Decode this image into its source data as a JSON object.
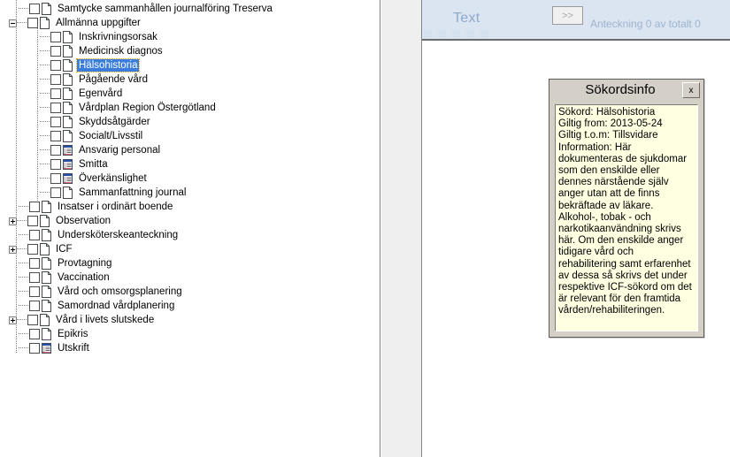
{
  "tree": {
    "items": [
      {
        "label": "Samtycke sammanhållen journalföring Treserva",
        "level": 1,
        "twisty": "none",
        "icon": "document-icon",
        "selected": false
      },
      {
        "label": "Allmänna uppgifter",
        "level": 1,
        "twisty": "minus",
        "icon": "document-icon",
        "selected": false
      },
      {
        "label": "Inskrivningsorsak",
        "level": 2,
        "twisty": "none",
        "icon": "document-icon",
        "selected": false
      },
      {
        "label": "Medicinsk diagnos",
        "level": 2,
        "twisty": "none",
        "icon": "document-icon",
        "selected": false
      },
      {
        "label": "Hälsohistoria",
        "level": 2,
        "twisty": "none",
        "icon": "document-icon",
        "selected": true
      },
      {
        "label": "Pågående vård",
        "level": 2,
        "twisty": "none",
        "icon": "document-icon",
        "selected": false
      },
      {
        "label": "Egenvård",
        "level": 2,
        "twisty": "none",
        "icon": "document-icon",
        "selected": false
      },
      {
        "label": "Vårdplan Region Östergötland",
        "level": 2,
        "twisty": "none",
        "icon": "document-icon",
        "selected": false
      },
      {
        "label": "Skyddsåtgärder",
        "level": 2,
        "twisty": "none",
        "icon": "document-icon",
        "selected": false
      },
      {
        "label": "Socialt/Livsstil",
        "level": 2,
        "twisty": "none",
        "icon": "document-icon",
        "selected": false
      },
      {
        "label": "Ansvarig personal",
        "level": 2,
        "twisty": "none",
        "icon": "form-list-icon",
        "selected": false
      },
      {
        "label": "Smitta",
        "level": 2,
        "twisty": "none",
        "icon": "form-list-icon",
        "selected": false
      },
      {
        "label": "Överkänslighet",
        "level": 2,
        "twisty": "none",
        "icon": "form-list-icon",
        "selected": false
      },
      {
        "label": "Sammanfattning journal",
        "level": 2,
        "twisty": "none",
        "icon": "document-icon",
        "selected": false
      },
      {
        "label": "Insatser i ordinärt boende",
        "level": 1,
        "twisty": "none",
        "icon": "document-icon",
        "selected": false
      },
      {
        "label": "Observation",
        "level": 1,
        "twisty": "plus",
        "icon": "document-icon",
        "selected": false
      },
      {
        "label": "Undersköterskeanteckning",
        "level": 1,
        "twisty": "none",
        "icon": "document-icon",
        "selected": false
      },
      {
        "label": "ICF",
        "level": 1,
        "twisty": "plus",
        "icon": "document-icon",
        "selected": false
      },
      {
        "label": "Provtagning",
        "level": 1,
        "twisty": "none",
        "icon": "document-icon",
        "selected": false
      },
      {
        "label": "Vaccination",
        "level": 1,
        "twisty": "none",
        "icon": "document-icon",
        "selected": false
      },
      {
        "label": "Vård och omsorgsplanering",
        "level": 1,
        "twisty": "none",
        "icon": "document-icon",
        "selected": false
      },
      {
        "label": "Samordnad vårdplanering",
        "level": 1,
        "twisty": "none",
        "icon": "document-icon",
        "selected": false
      },
      {
        "label": "Vård i livets slutskede",
        "level": 1,
        "twisty": "plus",
        "icon": "document-icon",
        "selected": false
      },
      {
        "label": "Epikris",
        "level": 1,
        "twisty": "none",
        "icon": "document-icon",
        "selected": false
      },
      {
        "label": "Utskrift",
        "level": 1,
        "twisty": "none",
        "icon": "form-list-icon",
        "selected": false
      }
    ]
  },
  "right_header": {
    "tab_label": "Text",
    "next_button_label": ">>",
    "note_counter": "Anteckning 0 av totalt 0"
  },
  "sokordsinfo": {
    "title": "Sökordsinfo",
    "close_label": "x",
    "line_sokord": "Sökord: Hälsohistoria",
    "line_giltig_from": "Giltig from: 2013-05-24",
    "line_giltig_tom": "Giltig t.o.m: Tillsvidare",
    "line_information": "Information: Här dokumenteras de sjukdomar som den enskilde eller dennes närstående själv anger utan att de finns bekräftade av läkare. Alkohol-, tobak - och narkotikaanvändning skrivs här. Om den enskilde anger tidigare vård och rehabilitering samt erfarenhet av dessa så skrivs det under respektive ICF-sökord om det är relevant för den framtida vården/rehabiliteringen."
  },
  "colors": {
    "selection_blue": "#3a7ddc",
    "header_blue": "#dbe5f1",
    "tooltip_yellow": "#ffffe1",
    "dialog_gray": "#d4d0c8"
  }
}
